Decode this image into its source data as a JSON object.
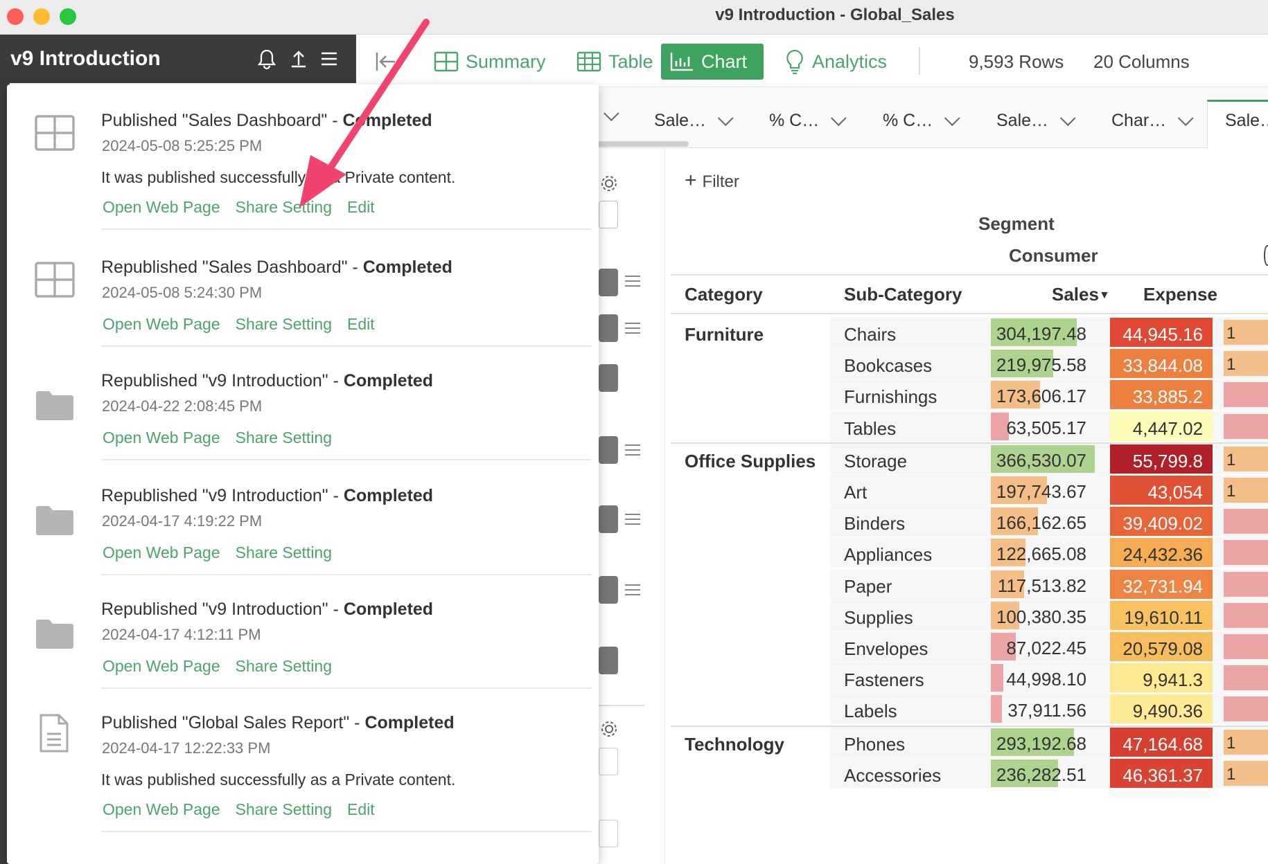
{
  "window": {
    "title": "v9 Introduction - Global_Sales"
  },
  "sidebar": {
    "project_name": "v9 Introduction"
  },
  "toolbar": {
    "summary": "Summary",
    "table": "Table",
    "chart": "Chart",
    "analytics": "Analytics",
    "rows": "9,593 Rows",
    "columns": "20 Columns"
  },
  "column_headers": [
    "Sale…",
    "% C…",
    "% C…",
    "Sale…",
    "Char…",
    "Sale…"
  ],
  "filter": {
    "label": "Filter"
  },
  "pivot": {
    "segment_label": "Segment",
    "segment_value": "Consumer",
    "headers": {
      "category": "Category",
      "sub_category": "Sub-Category",
      "sales": "Sales",
      "expense": "Expense"
    },
    "groups": [
      {
        "category": "Furniture",
        "rows": [
          {
            "sub": "Chairs",
            "sales": "304,197.48",
            "expense": "44,945.16"
          },
          {
            "sub": "Bookcases",
            "sales": "219,975.58",
            "expense": "33,844.08"
          },
          {
            "sub": "Furnishings",
            "sales": "173,606.17",
            "expense": "33,885.2"
          },
          {
            "sub": "Tables",
            "sales": "63,505.17",
            "expense": "4,447.02"
          }
        ]
      },
      {
        "category": "Office Supplies",
        "rows": [
          {
            "sub": "Storage",
            "sales": "366,530.07",
            "expense": "55,799.8"
          },
          {
            "sub": "Art",
            "sales": "197,743.67",
            "expense": "43,054"
          },
          {
            "sub": "Binders",
            "sales": "166,162.65",
            "expense": "39,409.02"
          },
          {
            "sub": "Appliances",
            "sales": "122,665.08",
            "expense": "24,432.36"
          },
          {
            "sub": "Paper",
            "sales": "117,513.82",
            "expense": "32,731.94"
          },
          {
            "sub": "Supplies",
            "sales": "100,380.35",
            "expense": "19,610.11"
          },
          {
            "sub": "Envelopes",
            "sales": "87,022.45",
            "expense": "20,579.08"
          },
          {
            "sub": "Fasteners",
            "sales": "44,998.10",
            "expense": "9,941.3"
          },
          {
            "sub": "Labels",
            "sales": "37,911.56",
            "expense": "9,490.36"
          }
        ]
      },
      {
        "category": "Technology",
        "rows": [
          {
            "sub": "Phones",
            "sales": "293,192.68",
            "expense": "47,164.68"
          },
          {
            "sub": "Accessories",
            "sales": "236,282.51",
            "expense": "46,361.37"
          }
        ]
      }
    ],
    "right_cut_values": [
      "1",
      "1",
      "",
      "",
      "1",
      "1",
      "",
      "",
      "",
      "",
      "",
      "",
      "",
      "1",
      "1"
    ]
  },
  "notifications": [
    {
      "icon": "dashboard-icon",
      "prefix": "Published \"Sales Dashboard\" - ",
      "status": "Completed",
      "date": "2024-05-08 5:25:25 PM",
      "message": "It was published successfully as a Private content.",
      "links": [
        "Open Web Page",
        "Share Setting",
        "Edit"
      ]
    },
    {
      "icon": "dashboard-icon",
      "prefix": "Republished \"Sales Dashboard\" - ",
      "status": "Completed",
      "date": "2024-05-08 5:24:30 PM",
      "message": "",
      "links": [
        "Open Web Page",
        "Share Setting",
        "Edit"
      ]
    },
    {
      "icon": "folder-icon",
      "prefix": "Republished \"v9 Introduction\" - ",
      "status": "Completed",
      "date": "2024-04-22 2:08:45 PM",
      "message": "",
      "links": [
        "Open Web Page",
        "Share Setting"
      ]
    },
    {
      "icon": "folder-icon",
      "prefix": "Republished \"v9 Introduction\" - ",
      "status": "Completed",
      "date": "2024-04-17 4:19:22 PM",
      "message": "",
      "links": [
        "Open Web Page",
        "Share Setting"
      ]
    },
    {
      "icon": "folder-icon",
      "prefix": "Republished \"v9 Introduction\" - ",
      "status": "Completed",
      "date": "2024-04-17 4:12:11 PM",
      "message": "",
      "links": [
        "Open Web Page",
        "Share Setting"
      ]
    },
    {
      "icon": "document-icon",
      "prefix": "Published \"Global Sales Report\" - ",
      "status": "Completed",
      "date": "2024-04-17 12:22:33 PM",
      "message": "It was published successfully as a Private content.",
      "links": [
        "Open Web Page",
        "Share Setting",
        "Edit"
      ]
    }
  ],
  "colors": {
    "accent": "#3da35f",
    "link": "#4aa56a",
    "sidebar": "#3b3b3b",
    "annotation_arrow": "#f0436e"
  }
}
